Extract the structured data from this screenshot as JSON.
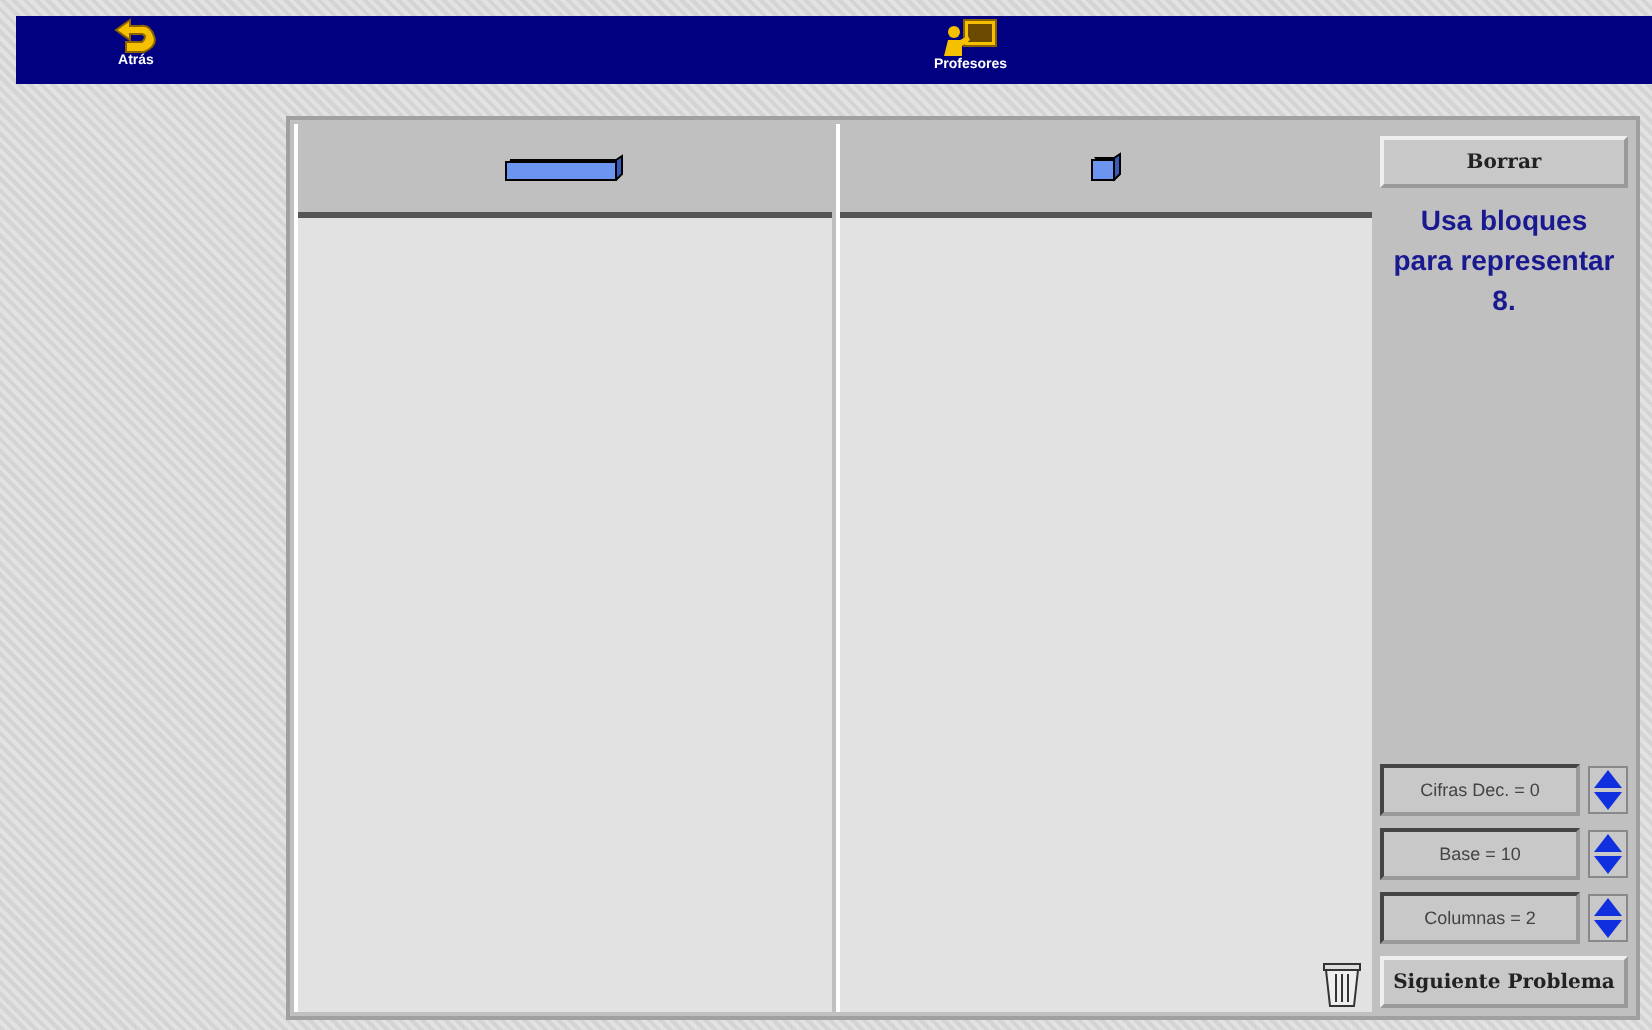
{
  "toolbar": {
    "back": {
      "label": "Atrás"
    },
    "teachers": {
      "label": "Profesores"
    }
  },
  "columns": [
    {
      "kind": "rod"
    },
    {
      "kind": "unit"
    }
  ],
  "side": {
    "clear_button": "Borrar",
    "instruction": "Usa bloques para representar 8.",
    "settings": [
      {
        "label": "Cifras Dec. = 0"
      },
      {
        "label": "Base = 10"
      },
      {
        "label": "Columnas = 2"
      }
    ],
    "next_button": "Siguiente Problema"
  }
}
